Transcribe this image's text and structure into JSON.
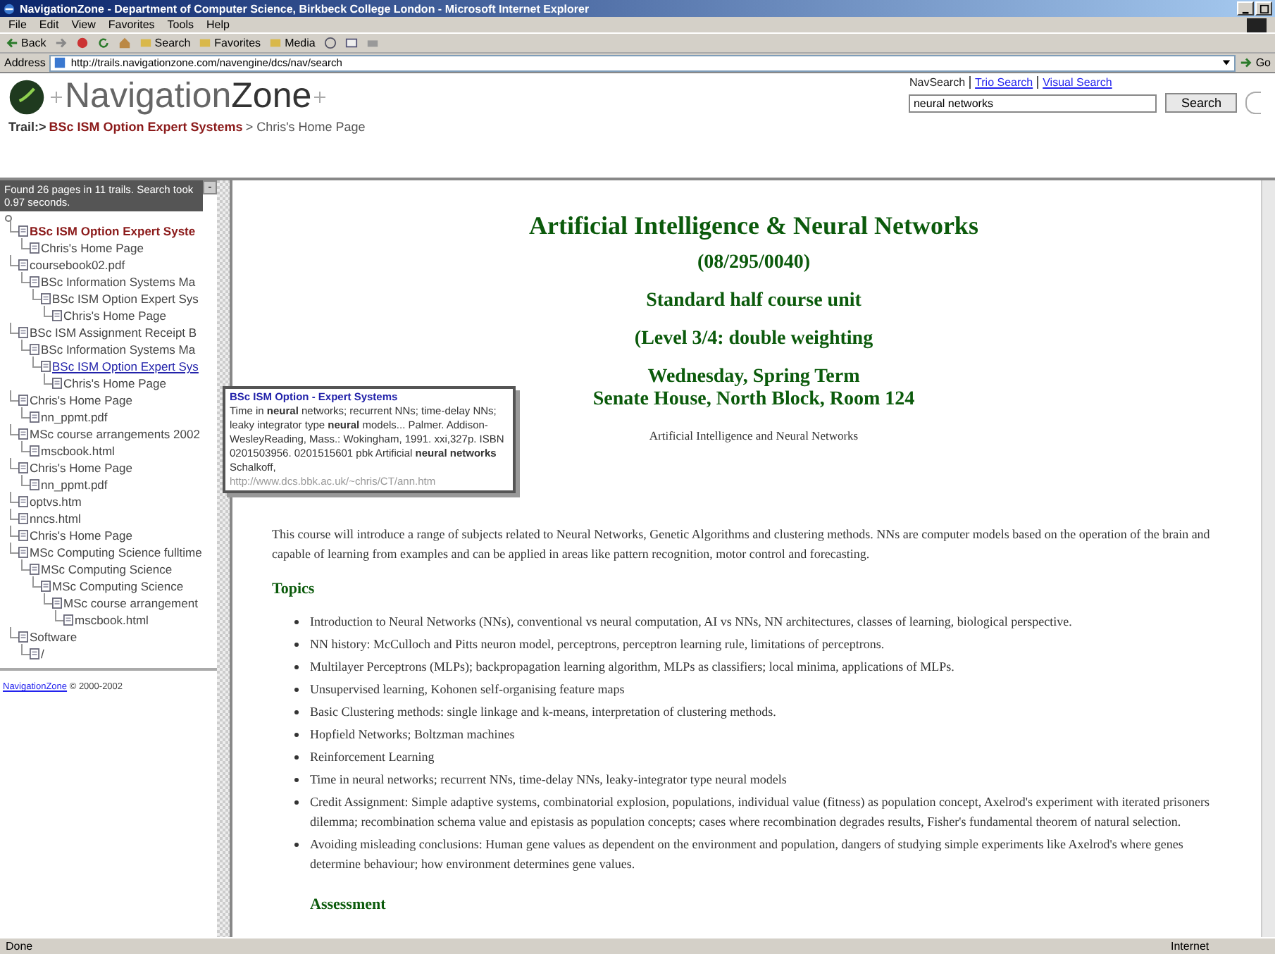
{
  "window": {
    "title": "NavigationZone - Department of Computer Science, Birkbeck College London - Microsoft Internet Explorer"
  },
  "menu": [
    "File",
    "Edit",
    "View",
    "Favorites",
    "Tools",
    "Help"
  ],
  "toolbar": [
    {
      "label": "Back"
    },
    {
      "label": "Search"
    },
    {
      "label": "Favorites"
    },
    {
      "label": "Media"
    }
  ],
  "address": {
    "label": "Address",
    "value": "http://trails.navigationzone.com/navengine/dcs/nav/search",
    "go": "Go"
  },
  "header": {
    "logo_light": "Navigation",
    "logo_bold": "Zone",
    "trail_label": "Trail:>",
    "trail_link": "BSc ISM Option Expert Systems",
    "trail_rest": "> Chris's Home Page",
    "search_links": [
      {
        "label": "NavSearch",
        "link": false
      },
      {
        "label": "Trio Search",
        "link": true
      },
      {
        "label": "Visual Search",
        "link": true
      }
    ],
    "search_value": "neural networks",
    "search_button": "Search"
  },
  "sidebar": {
    "summary": "Found 26 pages in 11 trails. Search took 0.97 seconds.",
    "collapse": "-",
    "tree": [
      {
        "label": "BSc ISM Option Expert Syste",
        "selected": true,
        "hovered": false,
        "children": [
          {
            "label": "Chris's Home Page",
            "selected": false,
            "hovered": false
          }
        ]
      },
      {
        "label": "coursebook02.pdf",
        "selected": false,
        "hovered": false,
        "children": [
          {
            "label": "BSc Information Systems Ma",
            "selected": false,
            "hovered": false,
            "children": [
              {
                "label": "BSc ISM Option Expert Sys",
                "selected": false,
                "hovered": false,
                "children": [
                  {
                    "label": "Chris's Home Page",
                    "selected": false,
                    "hovered": false
                  }
                ]
              }
            ]
          }
        ]
      },
      {
        "label": "BSc ISM Assignment Receipt B",
        "selected": false,
        "hovered": false,
        "children": [
          {
            "label": "BSc Information Systems Ma",
            "selected": false,
            "hovered": false,
            "children": [
              {
                "label": "BSc ISM Option Expert Sys",
                "selected": false,
                "hovered": true,
                "children": [
                  {
                    "label": "Chris's Home Page",
                    "selected": false,
                    "hovered": false
                  }
                ]
              }
            ]
          }
        ]
      },
      {
        "label": "Chris's Home Page",
        "selected": false,
        "hovered": false,
        "children": [
          {
            "label": "nn_ppmt.pdf",
            "selected": false,
            "hovered": false
          }
        ]
      },
      {
        "label": "MSc course arrangements 2002",
        "selected": false,
        "hovered": false,
        "children": [
          {
            "label": "mscbook.html",
            "selected": false,
            "hovered": false
          }
        ]
      },
      {
        "label": "Chris's Home Page",
        "selected": false,
        "hovered": false,
        "children": [
          {
            "label": "nn_ppmt.pdf",
            "selected": false,
            "hovered": false
          }
        ]
      },
      {
        "label": "optvs.htm",
        "selected": false,
        "hovered": false
      },
      {
        "label": "nncs.html",
        "selected": false,
        "hovered": false
      },
      {
        "label": "Chris's Home Page",
        "selected": false,
        "hovered": false
      },
      {
        "label": "MSc Computing Science fulltime",
        "selected": false,
        "hovered": false,
        "children": [
          {
            "label": "MSc Computing Science",
            "selected": false,
            "hovered": false,
            "children": [
              {
                "label": "MSc Computing Science",
                "selected": false,
                "hovered": false,
                "children": [
                  {
                    "label": "MSc course arrangement",
                    "selected": false,
                    "hovered": false,
                    "children": [
                      {
                        "label": "mscbook.html",
                        "selected": false,
                        "hovered": false
                      }
                    ]
                  }
                ]
              }
            ]
          }
        ]
      },
      {
        "label": "Software",
        "selected": false,
        "hovered": false,
        "children": [
          {
            "label": "/",
            "selected": false,
            "hovered": false
          }
        ]
      }
    ],
    "footer_link": "NavigationZone",
    "footer_text": "© 2000-2002"
  },
  "tooltip": {
    "title": "BSc ISM Option - Expert Systems",
    "text": "Time in **neural** networks; recurrent NNs; time-delay NNs; leaky integrator type **neural** models... Palmer. Addison-WesleyReading, Mass.: Wokingham, 1991. xxi,327p. ISBN 0201503956. 0201515601 pbk Artificial **neural networks** Schalkoff,",
    "url": "http://www.dcs.bbk.ac.uk/~chris/CT/ann.htm"
  },
  "content": {
    "title": "Artificial Intelligence & Neural Networks",
    "code": "(08/295/0040)",
    "unit": "Standard half course unit",
    "level": "(Level 3/4: double weighting",
    "term": "Wednesday, Spring Term",
    "place": "Senate House, North Block, Room 124",
    "subtitle": "Artificial Intelligence and Neural Networks",
    "intro": "This course will introduce a range of subjects related to Neural Networks, Genetic Algorithms and clustering methods. NNs are computer models based on the operation of the brain and capable of learning from examples and can be applied in areas like pattern recognition, motor control and forecasting.",
    "topics_heading": "Topics",
    "topics": [
      "Introduction to Neural Networks (NNs), conventional vs neural computation, AI vs NNs, NN architectures, classes of learning, biological perspective.",
      "NN history: McCulloch and Pitts neuron model, perceptrons, perceptron learning rule, limitations of perceptrons.",
      "Multilayer Perceptrons (MLPs); backpropagation learning algorithm, MLPs as classifiers; local minima, applications of MLPs.",
      "Unsupervised learning, Kohonen self-organising feature maps",
      "Basic Clustering methods: single linkage and k-means, interpretation of clustering methods.",
      "Hopfield Networks; Boltzman machines",
      "Reinforcement Learning",
      "Time in neural networks; recurrent NNs, time-delay NNs, leaky-integrator type neural models",
      "Credit Assignment: Simple adaptive systems, combinatorial explosion, populations, individual value (fitness) as population concept, Axelrod's experiment with iterated prisoners dilemma; recombination schema value and epistasis as population concepts; cases where recombination degrades results, Fisher's fundamental theorem of natural selection.",
      "Avoiding misleading conclusions: Human gene values as dependent on the environment and population, dangers of studying simple experiments like Axelrod's where genes determine behaviour; how environment determines gene values."
    ],
    "assessment_heading": "Assessment"
  },
  "status": {
    "text": "Done",
    "zone": "Internet"
  }
}
